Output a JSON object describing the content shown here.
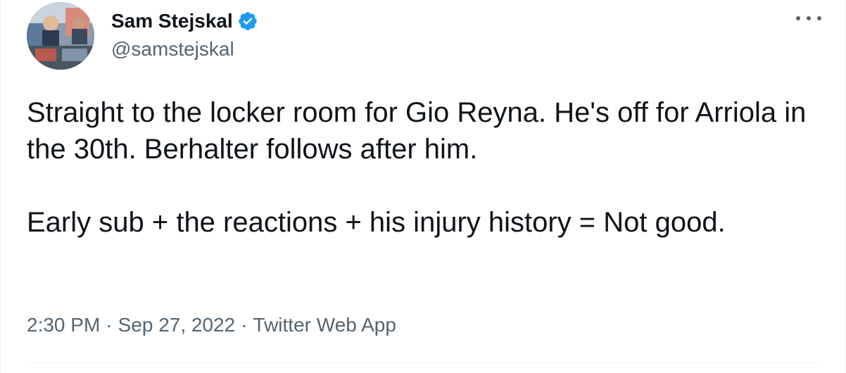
{
  "author": {
    "display_name": "Sam Stejskal",
    "handle": "@samstejskal",
    "verified_icon": "verified-badge-icon",
    "avatar_icon": "profile-photo"
  },
  "menu": {
    "more_icon": "more-horizontal-icon"
  },
  "tweet": {
    "paragraphs": [
      "Straight to the locker room for Gio Reyna. He's off for Arriola in the 30th. Berhalter follows after him.",
      "Early sub + the reactions + his injury history = Not good."
    ]
  },
  "meta": {
    "time": "2:30 PM",
    "separator": "·",
    "date": "Sep 27, 2022",
    "source": "Twitter Web App"
  },
  "colors": {
    "text": "#0f1419",
    "secondary": "#536471",
    "verified": "#1d9bf0",
    "divider": "#eff3f4"
  }
}
